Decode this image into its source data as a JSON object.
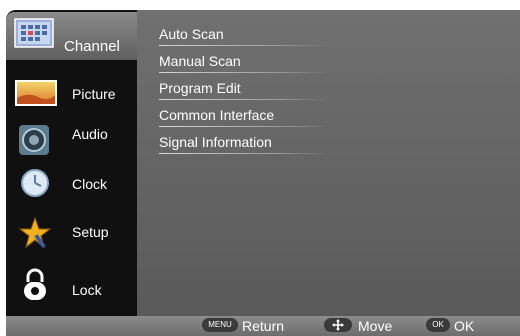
{
  "sidebar": {
    "items": [
      {
        "label": "Channel",
        "icon": "channel-grid-icon"
      },
      {
        "label": "Picture",
        "icon": "picture-icon"
      },
      {
        "label": "Audio",
        "icon": "audio-speaker-icon"
      },
      {
        "label": "Clock",
        "icon": "clock-icon"
      },
      {
        "label": "Setup",
        "icon": "setup-star-icon"
      },
      {
        "label": "Lock",
        "icon": "padlock-icon"
      }
    ]
  },
  "menu": {
    "items": [
      {
        "label": "Auto Scan"
      },
      {
        "label": "Manual Scan"
      },
      {
        "label": "Program Edit"
      },
      {
        "label": "Common Interface"
      },
      {
        "label": "Signal Information"
      }
    ]
  },
  "footer": {
    "return_key": "MENU",
    "return_label": "Return",
    "move_label": "Move",
    "ok_key": "OK",
    "ok_label": "OK"
  },
  "colors": {
    "panel": "#6a6a6a",
    "sidebar": "#101010",
    "active_item": "#7a7a7a",
    "text": "#ffffff"
  }
}
